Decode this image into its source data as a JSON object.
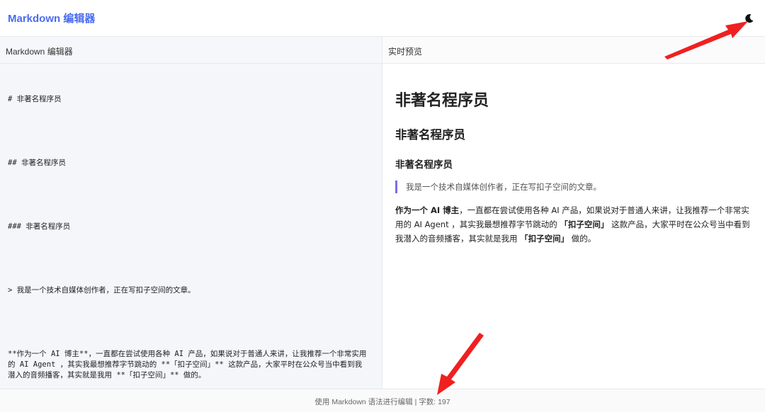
{
  "app": {
    "title": "Markdown 编辑器"
  },
  "theme_toggle": {
    "icon": "moon-icon"
  },
  "editor": {
    "header": "Markdown 编辑器",
    "lines": [
      "# 非著名程序员",
      "## 非著名程序员",
      "### 非著名程序员",
      "> 我是一个技术自媒体创作者，正在写扣子空间的文章。",
      "**作为一个 AI 博主**，一直都在尝试使用各种 AI 产品，如果说对于普通人来讲，让我推荐一个非常实用的 AI Agent ，其实我最想推荐字节跳动的 **「扣子空间」** 这款产品，大家平时在公众号当中看到我潜入的音频播客，其实就是我用 **「扣子空间」** 做的。"
    ]
  },
  "preview": {
    "header": "实时预览",
    "h1": "非著名程序员",
    "h2": "非著名程序员",
    "h3": "非著名程序员",
    "blockquote": "我是一个技术自媒体创作者，正在写扣子空间的文章。",
    "paragraph": {
      "bold_1": "作为一个 AI 博主",
      "text_1": "，一直都在尝试使用各种 AI 产品，如果说对于普通人来讲，让我推荐一个非常实用的 AI Agent ，其实我最想推荐字节跳动的 ",
      "bold_2": "「扣子空间」",
      "text_2": " 这款产品，大家平时在公众号当中看到我潜入的音频播客，其实就是我用 ",
      "bold_3": "「扣子空间」",
      "text_3": " 做的。"
    }
  },
  "footer": {
    "status": "使用 Markdown 语法进行编辑 | 字数: 197"
  },
  "colors": {
    "accent": "#4a6cf0",
    "blockquote_bar": "#7b6ee6",
    "arrow": "#f02020"
  }
}
